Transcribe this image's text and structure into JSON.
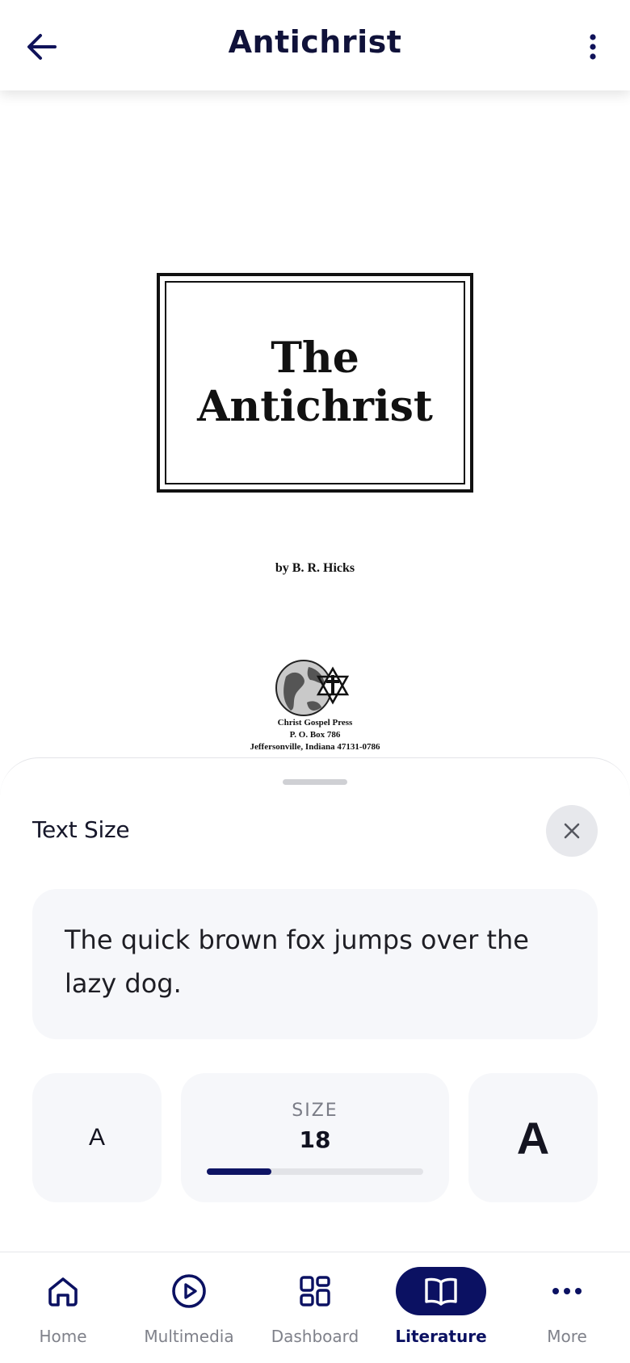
{
  "app_bar": {
    "title": "Antichrist",
    "back_icon": "arrow-left-icon",
    "menu_icon": "more-vertical-icon"
  },
  "document": {
    "cover_title_line1": "The",
    "cover_title_line2": "Antichrist",
    "author": "by B. R. Hicks",
    "publisher_line1": "Christ Gospel Press",
    "publisher_line2": "P. O. Box 786",
    "publisher_line3": "Jeffersonville, Indiana 47131-0786"
  },
  "text_size_sheet": {
    "title": "Text Size",
    "preview_text": "The quick brown fox jumps over the lazy dog.",
    "decrease_label": "A",
    "increase_label": "A",
    "size_label": "SIZE",
    "size_value": "18",
    "slider_fraction": 0.3
  },
  "bottom_nav": {
    "items": [
      {
        "label": "Home",
        "icon": "home-icon",
        "active": false
      },
      {
        "label": "Multimedia",
        "icon": "play-circle-icon",
        "active": false
      },
      {
        "label": "Dashboard",
        "icon": "grid-icon",
        "active": false
      },
      {
        "label": "Literature",
        "icon": "book-open-icon",
        "active": true
      },
      {
        "label": "More",
        "icon": "more-horizontal-icon",
        "active": false
      }
    ]
  },
  "colors": {
    "brand_navy": "#0b1162",
    "muted_text": "#7f818a",
    "card_background": "#f6f7fa"
  }
}
